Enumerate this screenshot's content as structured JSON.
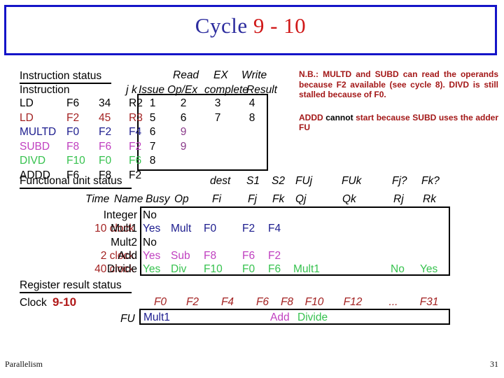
{
  "title": {
    "word": "Cycle",
    "number": "9 - 10"
  },
  "instruction_status": {
    "heading": "Instruction status",
    "top_headers": [
      "Read",
      "EX",
      "Write"
    ],
    "columns": [
      "Instruction",
      "j",
      "k",
      "Issue",
      "Op/Ex",
      "complete",
      "Result"
    ],
    "rows": [
      {
        "color": "black",
        "op": "LD",
        "dest": "F6",
        "j": "34",
        "k": "R2",
        "issue": "1",
        "read": "2",
        "exec": "3",
        "write": "4",
        "read_color": "black"
      },
      {
        "color": "red",
        "op": "LD",
        "dest": "F2",
        "j": "45",
        "k": "R3",
        "issue": "5",
        "read": "6",
        "exec": "7",
        "write": "8",
        "read_color": "black"
      },
      {
        "color": "navy",
        "op": "MULTD",
        "dest": "F0",
        "j": "F2",
        "k": "F4",
        "issue": "6",
        "read": "9",
        "exec": "",
        "write": "",
        "read_color": "plum"
      },
      {
        "color": "purple",
        "op": "SUBD",
        "dest": "F8",
        "j": "F6",
        "k": "F2",
        "issue": "7",
        "read": "9",
        "exec": "",
        "write": "",
        "read_color": "plum"
      },
      {
        "color": "green",
        "op": "DIVD",
        "dest": "F10",
        "j": "F0",
        "k": "F6",
        "issue": "8",
        "read": "",
        "exec": "",
        "write": "",
        "read_color": "black"
      },
      {
        "color": "black",
        "op": "ADDD",
        "dest": "F6",
        "j": "F8",
        "k": "F2",
        "issue": "",
        "read": "",
        "exec": "",
        "write": "",
        "read_color": "black"
      }
    ]
  },
  "functional_unit_status": {
    "heading": "Functional unit status",
    "top_headers": [
      "dest",
      "S1",
      "S2",
      "FUj",
      "FUk",
      "Fj?",
      "Fk?"
    ],
    "sub_headers": [
      "Time",
      "Name",
      "Busy",
      "Op",
      "Fi",
      "Fj",
      "Fk",
      "Qj",
      "Qk",
      "Rj",
      "Rk"
    ],
    "rows": [
      {
        "color": "black",
        "time": "",
        "name": "Integer",
        "busy": "No",
        "op": "",
        "fi": "",
        "fj": "",
        "fk": "",
        "qj": "",
        "qk": "",
        "rj": "",
        "rk": ""
      },
      {
        "color": "navy",
        "time": "10 clock",
        "name": "Mult1",
        "busy": "Yes",
        "op": "Mult",
        "fi": "F0",
        "fj": "F2",
        "fk": "F4",
        "qj": "",
        "qk": "",
        "rj": "",
        "rk": ""
      },
      {
        "color": "black",
        "time": "",
        "name": "Mult2",
        "busy": "No",
        "op": "",
        "fi": "",
        "fj": "",
        "fk": "",
        "qj": "",
        "qk": "",
        "rj": "",
        "rk": ""
      },
      {
        "color": "purple",
        "time": "2 clock",
        "name": "Add",
        "busy": "Yes",
        "op": "Sub",
        "fi": "F8",
        "fj": "F6",
        "fk": "F2",
        "qj": "",
        "qk": "",
        "rj": "",
        "rk": ""
      },
      {
        "color": "green",
        "time": "40 clock",
        "name": "Divide",
        "busy": "Yes",
        "op": "Div",
        "fi": "F10",
        "fj": "F0",
        "fk": "F6",
        "qj": "Mult1",
        "qk": "",
        "rj": "No",
        "rk": "Yes"
      }
    ],
    "time_color": "red"
  },
  "register_result_status": {
    "heading": "Register result status",
    "clock_label": "Clock",
    "clock_value": "9-10",
    "fu_label": "FU",
    "registers": [
      "F0",
      "F2",
      "F4",
      "F6",
      "F8",
      "F10",
      "F12",
      "...",
      "F31"
    ],
    "fu_values": [
      {
        "reg": "F0",
        "value": "Mult1",
        "color": "navy"
      },
      {
        "reg": "F8",
        "value": "Add",
        "color": "purple"
      },
      {
        "reg": "F10",
        "value": "Divide",
        "color": "green"
      }
    ]
  },
  "note": {
    "line1_a": "N.B.: MULTD and SUBD can read the operands because F2 available (see cycle 8). DIVD is still stalled because of F0.",
    "para2_a": "ADDD ",
    "para2_black": "cannot",
    "para2_b": " start because SUBD uses the adder FU"
  },
  "footer": {
    "left": "Parallelism",
    "right": "31"
  },
  "colors": {
    "title_blue": "#2c2c9e",
    "title_red": "#d01818",
    "border_blue": "#1414c8",
    "red": "#a32222",
    "navy": "#1c1c8e",
    "purple": "#c040c0",
    "green": "#37c24f",
    "plum": "#8a3a8a",
    "note_red": "#a31818"
  }
}
